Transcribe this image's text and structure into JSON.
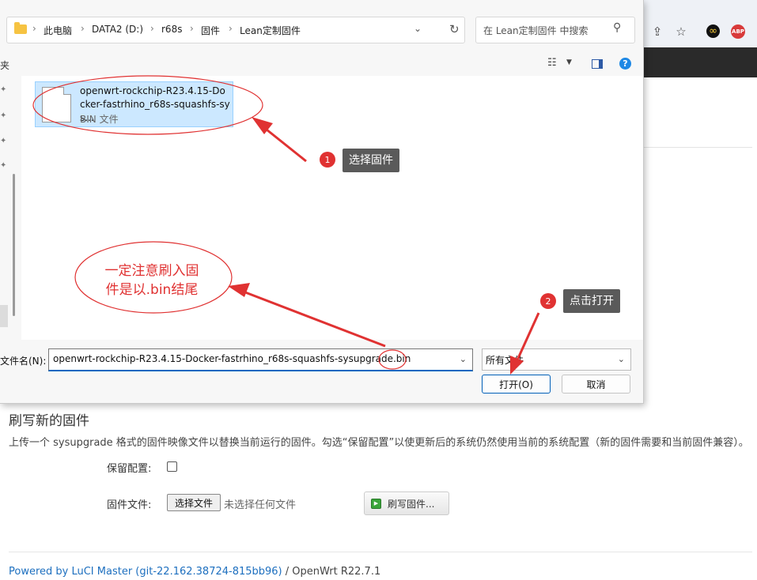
{
  "browser": {
    "icons": [
      "share-icon",
      "star-icon",
      "infinity-extension-icon",
      "adblock-icon"
    ],
    "abp_label": "ABP"
  },
  "dialog": {
    "breadcrumbs": [
      "此电脑",
      "DATA2 (D:)",
      "r68s",
      "固件",
      "Lean定制固件"
    ],
    "search_placeholder": "在 Lean定制固件 中搜索",
    "nav_header": "夹",
    "file": {
      "name": "openwrt-rockchip-R23.4.15-Docker-fastrhino_r68s-squashfs-sys...",
      "type": "BIN 文件"
    },
    "filename_label": "文件名(N):",
    "filename_value": "openwrt-rockchip-R23.4.15-Docker-fastrhino_r68s-squashfs-sysupgrade.bin",
    "filetype_value": "所有文件",
    "open_label": "打开(O)",
    "cancel_label": "取消",
    "help_label": "?"
  },
  "annotations": {
    "step1_badge": "1",
    "step1_text": "选择固件",
    "step2_badge": "2",
    "step2_text": "点击打开",
    "warning_line1": "一定注意刷入固",
    "warning_line2": "件是以.bin结尾",
    "accent_color": "#e03232"
  },
  "luci": {
    "title": "刷写新的固件",
    "description": "上传一个 sysupgrade 格式的固件映像文件以替换当前运行的固件。勾选“保留配置”以使更新后的系统仍然使用当前的系统配置（新的固件需要和当前固件兼容）。",
    "keep_settings_label": "保留配置:",
    "firmware_file_label": "固件文件:",
    "choose_file_label": "选择文件",
    "no_file_text": "未选择任何文件",
    "flash_button_label": "刷写固件...",
    "footer_link": "Powered by LuCI Master (git-22.162.38724-815bb96)",
    "footer_suffix": " / OpenWrt R22.7.1"
  }
}
